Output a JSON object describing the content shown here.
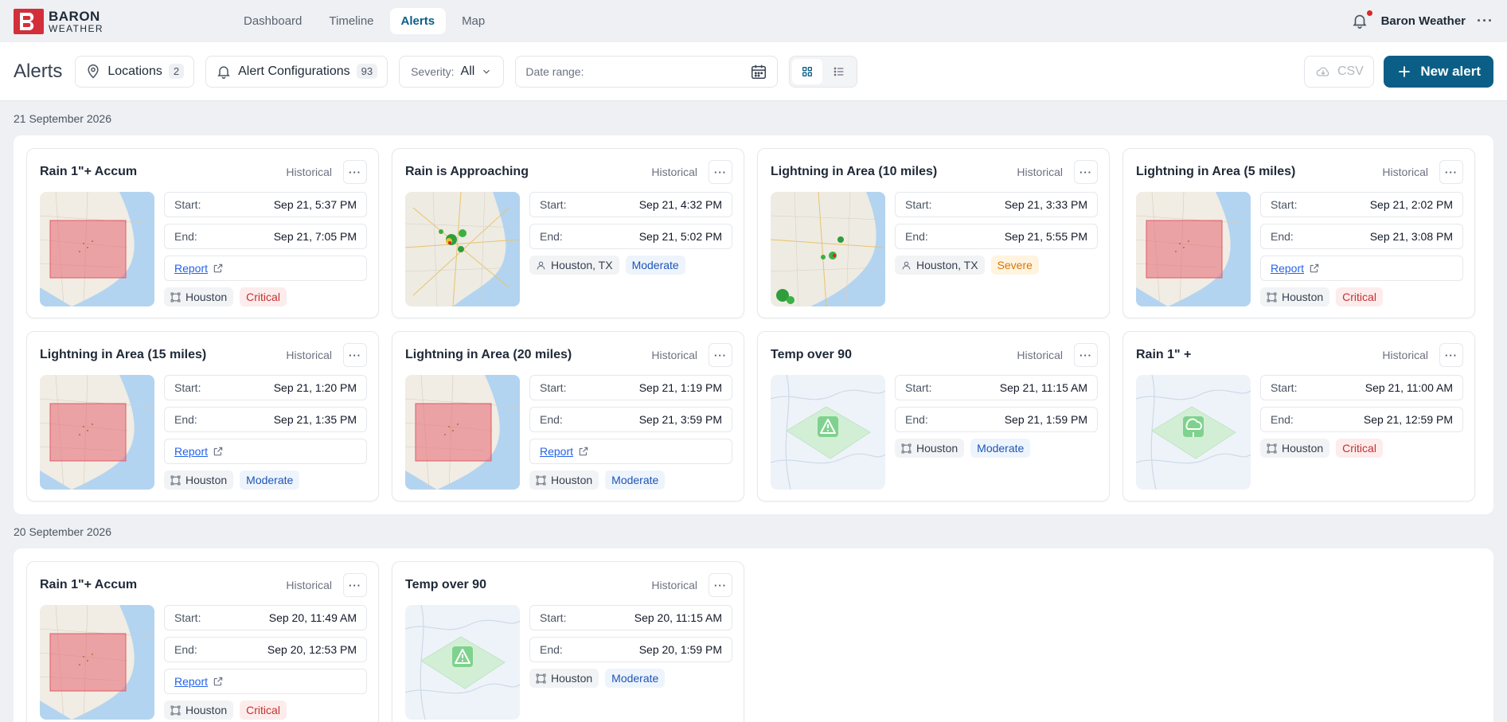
{
  "brand": {
    "line1": "BARON",
    "line2": "WEATHER"
  },
  "nav": {
    "tabs": [
      {
        "label": "Dashboard"
      },
      {
        "label": "Timeline"
      },
      {
        "label": "Alerts"
      },
      {
        "label": "Map"
      }
    ]
  },
  "user": {
    "name": "Baron Weather"
  },
  "toolbar": {
    "title": "Alerts",
    "locations_label": "Locations",
    "locations_count": "2",
    "configs_label": "Alert Configurations",
    "configs_count": "93",
    "severity_label": "Severity:",
    "severity_value": "All",
    "date_label": "Date range:",
    "csv_label": "CSV",
    "new_alert_label": "New alert"
  },
  "labels": {
    "start": "Start:",
    "end": "End:",
    "report": "Report"
  },
  "groups": [
    {
      "date": "21 September 2026",
      "cards": [
        {
          "title": "Rain 1\"+ Accum",
          "status": "Historical",
          "start": "Sep 21, 5:37 PM",
          "end": "Sep 21, 7:05 PM",
          "report": true,
          "location": "Houston",
          "loc_icon": "area-icon",
          "severity": "Critical",
          "thumb": "map-area"
        },
        {
          "title": "Rain is Approaching",
          "status": "Historical",
          "start": "Sep 21, 4:32 PM",
          "end": "Sep 21, 5:02 PM",
          "report": false,
          "location": "Houston, TX",
          "loc_icon": "person-icon",
          "severity": "Moderate",
          "thumb": "radar"
        },
        {
          "title": "Lightning in Area (10 miles)",
          "status": "Historical",
          "start": "Sep 21, 3:33 PM",
          "end": "Sep 21, 5:55 PM",
          "report": false,
          "location": "Houston, TX",
          "loc_icon": "person-icon",
          "severity": "Severe",
          "thumb": "radar2"
        },
        {
          "title": "Lightning in Area (5 miles)",
          "status": "Historical",
          "start": "Sep 21, 2:02 PM",
          "end": "Sep 21, 3:08 PM",
          "report": true,
          "location": "Houston",
          "loc_icon": "area-icon",
          "severity": "Critical",
          "thumb": "map-area"
        },
        {
          "title": "Lightning in Area (15 miles)",
          "status": "Historical",
          "start": "Sep 21, 1:20 PM",
          "end": "Sep 21, 1:35 PM",
          "report": true,
          "location": "Houston",
          "loc_icon": "area-icon",
          "severity": "Moderate",
          "thumb": "map-area"
        },
        {
          "title": "Lightning in Area (20 miles)",
          "status": "Historical",
          "start": "Sep 21, 1:19 PM",
          "end": "Sep 21, 3:59 PM",
          "report": true,
          "location": "Houston",
          "loc_icon": "area-icon",
          "severity": "Moderate",
          "thumb": "map-area"
        },
        {
          "title": "Temp over 90",
          "status": "Historical",
          "start": "Sep 21, 11:15 AM",
          "end": "Sep 21, 1:59 PM",
          "report": false,
          "location": "Houston",
          "loc_icon": "area-icon",
          "severity": "Moderate",
          "thumb": "placeholder-warning"
        },
        {
          "title": "Rain 1\" +",
          "status": "Historical",
          "start": "Sep 21, 11:00 AM",
          "end": "Sep 21, 12:59 PM",
          "report": false,
          "location": "Houston",
          "loc_icon": "area-icon",
          "severity": "Critical",
          "thumb": "placeholder-rain"
        }
      ]
    },
    {
      "date": "20 September 2026",
      "cards": [
        {
          "title": "Rain 1\"+ Accum",
          "status": "Historical",
          "start": "Sep 20, 11:49 AM",
          "end": "Sep 20, 12:53 PM",
          "report": true,
          "location": "Houston",
          "loc_icon": "area-icon",
          "severity": "Critical",
          "thumb": "map-area"
        },
        {
          "title": "Temp over 90",
          "status": "Historical",
          "start": "Sep 20, 11:15 AM",
          "end": "Sep 20, 1:59 PM",
          "report": false,
          "location": "Houston",
          "loc_icon": "area-icon",
          "severity": "Moderate",
          "thumb": "placeholder-warning"
        }
      ]
    }
  ]
}
